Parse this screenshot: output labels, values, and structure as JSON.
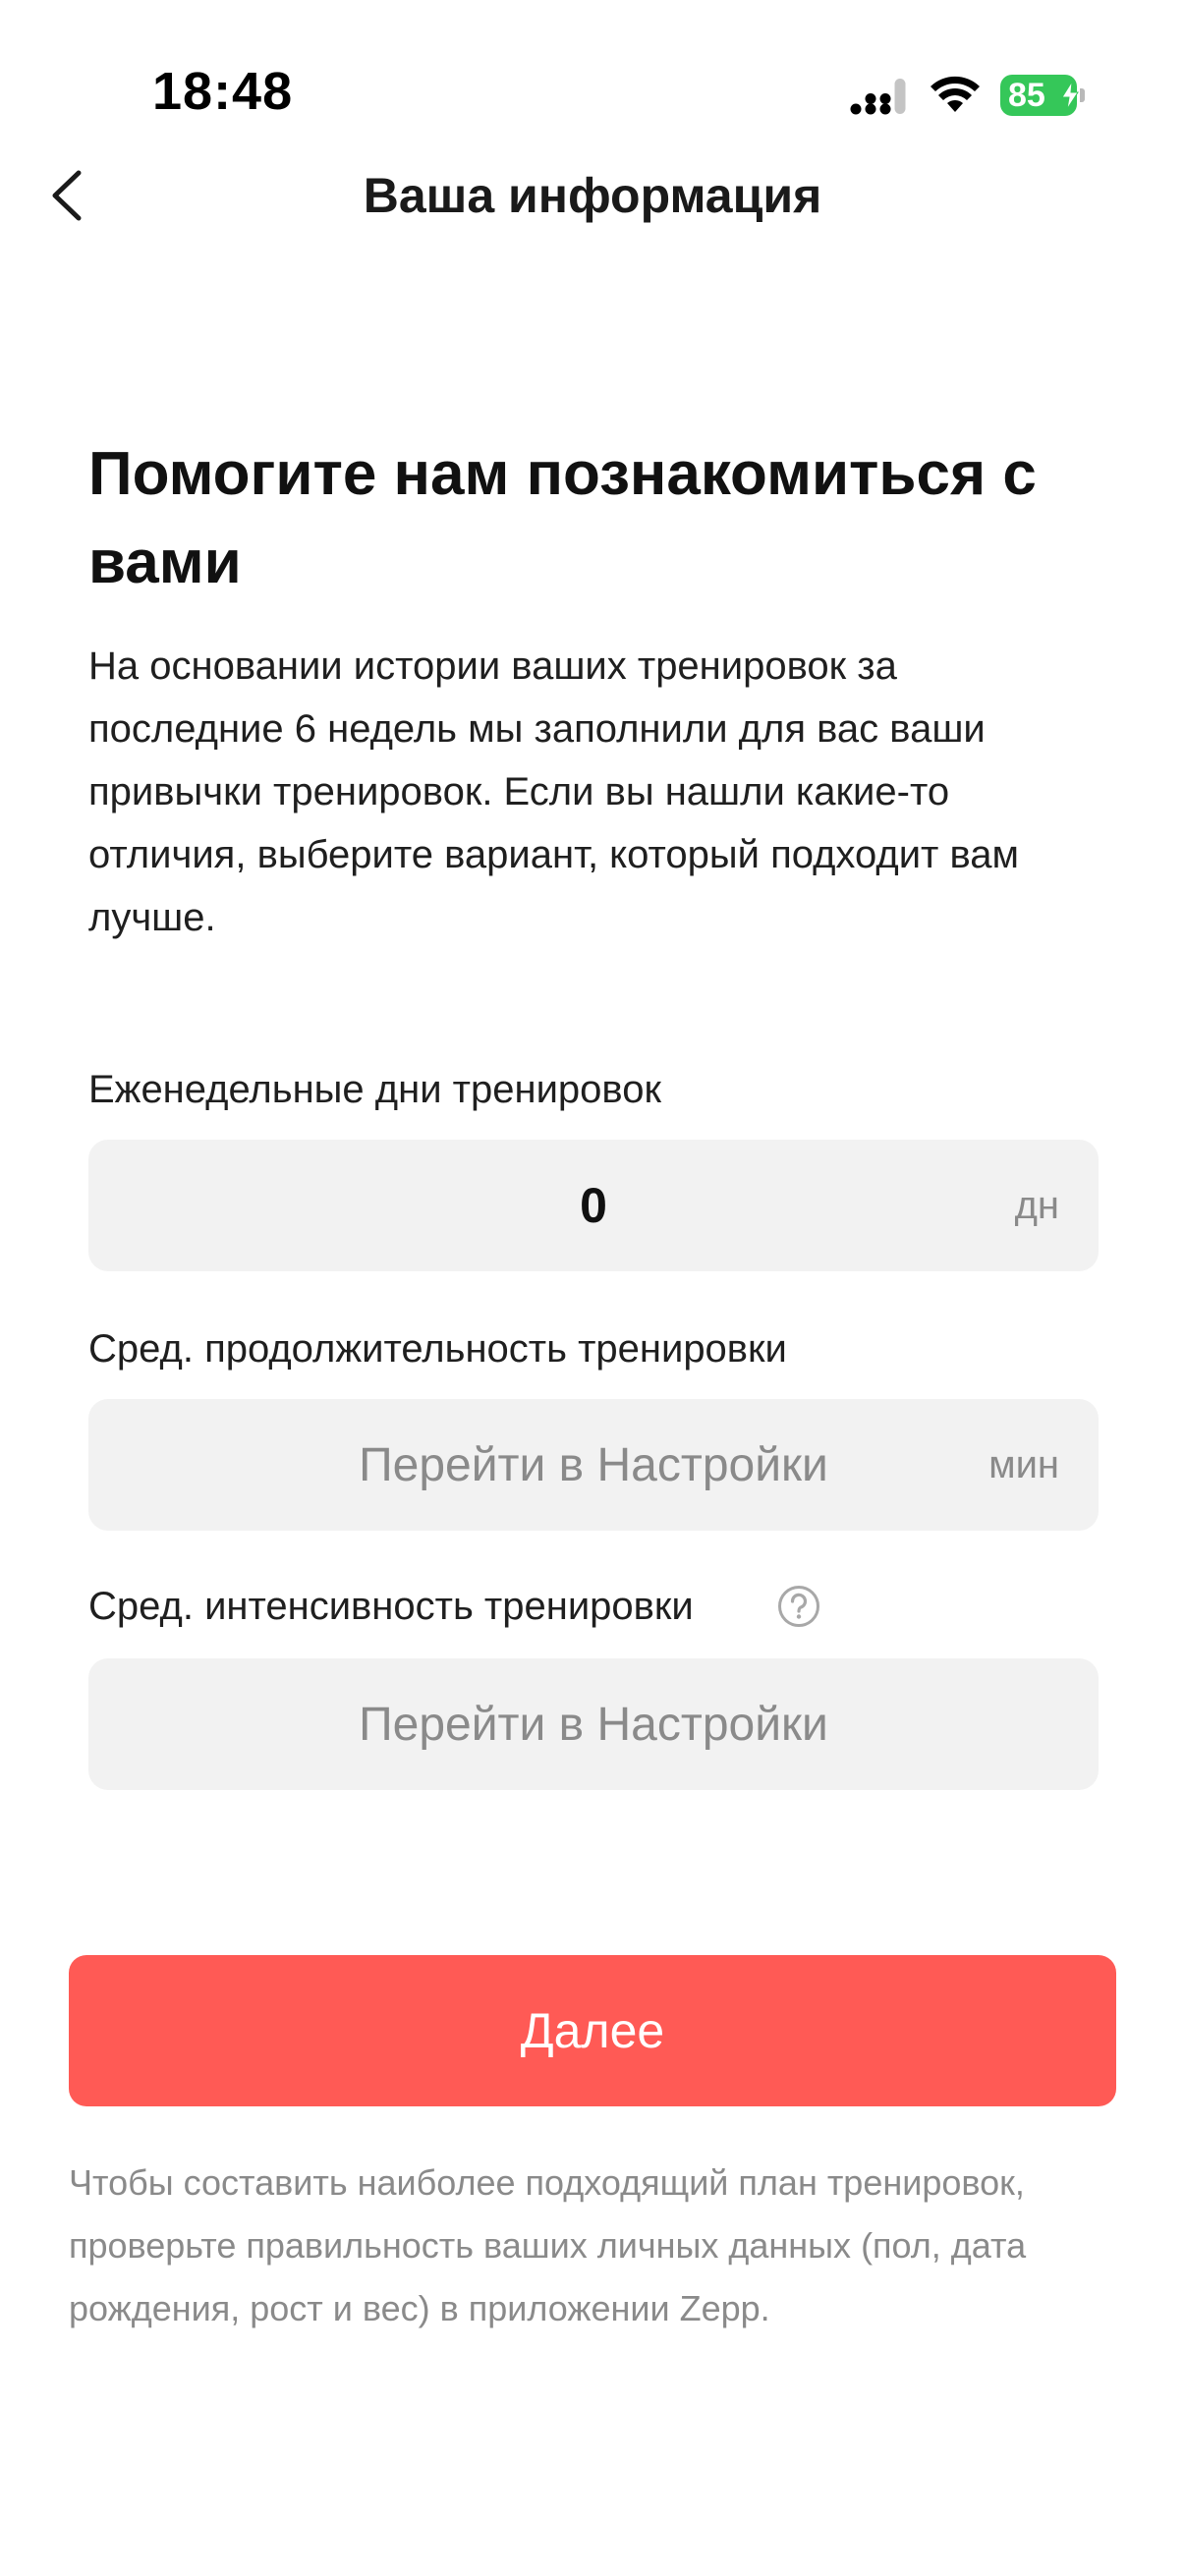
{
  "status_bar": {
    "time": "18:48",
    "battery_percent": "85",
    "icons": [
      "signal-icon",
      "wifi-icon",
      "battery-charging-icon"
    ],
    "battery_color": "#35c759"
  },
  "nav": {
    "title": "Ваша информация",
    "back_icon": "chevron-left-icon"
  },
  "main": {
    "heading": "Помогите нам познакомиться с вами",
    "intro": "На основании истории ваших тренировок за последние 6 недель мы заполнили для вас ваши привычки тренировок. Если вы нашли какие-то отличия, выберите вариант, который подходит вам лучше.",
    "fields": [
      {
        "label": "Еженедельные дни тренировок",
        "value": "0",
        "unit": "дн"
      },
      {
        "label": "Сред. продолжительность тренировки",
        "value": "Перейти в Настройки",
        "unit": "мин"
      },
      {
        "label": "Сред. интенсивность тренировки",
        "value": "Перейти в Настройки",
        "help_icon": "question-circle-icon"
      }
    ]
  },
  "actions": {
    "next_label": "Далее",
    "accent_color": "#ff5a55"
  },
  "footer": {
    "note": "Чтобы составить наиболее подходящий план тренировок, проверьте правильность ваших личных данных (пол, дата рождения, рост и вес) в приложении Zepp."
  }
}
